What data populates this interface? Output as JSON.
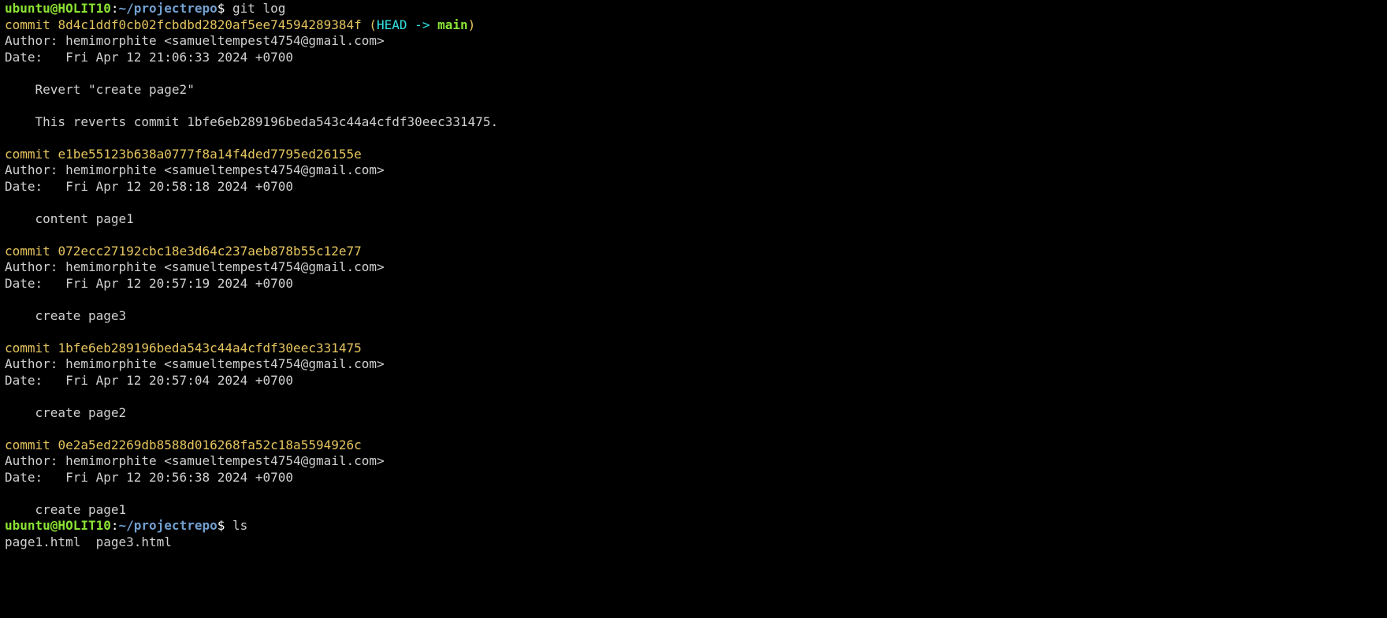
{
  "prompt1": {
    "user": "ubuntu@HOLIT10",
    "colon": ":",
    "path": "~/projectrepo",
    "dollar": "$ ",
    "cmd": "git log"
  },
  "commits": [
    {
      "line_commit_prefix": "commit ",
      "hash": "8d4c1ddf0cb02fcbdbd2820af5ee74594289384f",
      "ref_open": " (",
      "ref_head": "HEAD -> ",
      "ref_branch": "main",
      "ref_close": ")",
      "author": "Author: hemimorphite <samueltempest4754@gmail.com>",
      "date": "Date:   Fri Apr 12 21:06:33 2024 +0700",
      "msg_lines": [
        "",
        "    Revert \"create page2\"",
        "",
        "    This reverts commit 1bfe6eb289196beda543c44a4cfdf30eec331475.",
        ""
      ]
    },
    {
      "line_commit_prefix": "commit ",
      "hash": "e1be55123b638a0777f8a14f4ded7795ed26155e",
      "author": "Author: hemimorphite <samueltempest4754@gmail.com>",
      "date": "Date:   Fri Apr 12 20:58:18 2024 +0700",
      "msg_lines": [
        "",
        "    content page1",
        ""
      ]
    },
    {
      "line_commit_prefix": "commit ",
      "hash": "072ecc27192cbc18e3d64c237aeb878b55c12e77",
      "author": "Author: hemimorphite <samueltempest4754@gmail.com>",
      "date": "Date:   Fri Apr 12 20:57:19 2024 +0700",
      "msg_lines": [
        "",
        "    create page3",
        ""
      ]
    },
    {
      "line_commit_prefix": "commit ",
      "hash": "1bfe6eb289196beda543c44a4cfdf30eec331475",
      "author": "Author: hemimorphite <samueltempest4754@gmail.com>",
      "date": "Date:   Fri Apr 12 20:57:04 2024 +0700",
      "msg_lines": [
        "",
        "    create page2",
        ""
      ]
    },
    {
      "line_commit_prefix": "commit ",
      "hash": "0e2a5ed2269db8588d016268fa52c18a5594926c",
      "author": "Author: hemimorphite <samueltempest4754@gmail.com>",
      "date": "Date:   Fri Apr 12 20:56:38 2024 +0700",
      "msg_lines": [
        "",
        "    create page1"
      ]
    }
  ],
  "prompt2": {
    "user": "ubuntu@HOLIT10",
    "colon": ":",
    "path": "~/projectrepo",
    "dollar": "$ ",
    "cmd": "ls"
  },
  "ls_output": "page1.html  page3.html"
}
